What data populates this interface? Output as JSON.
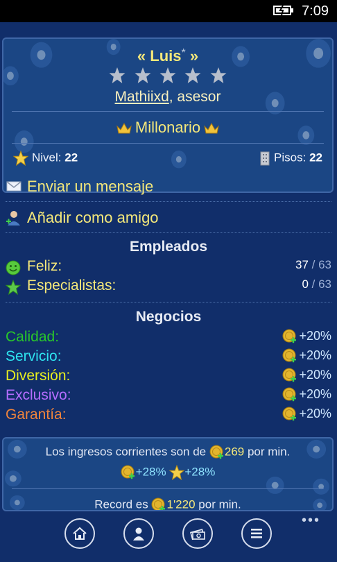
{
  "status_bar": {
    "time": "7:09"
  },
  "profile": {
    "title_open": "« ",
    "name": "Luis",
    "name_mark": "*",
    "title_close": " »",
    "star_rating": 0,
    "star_max": 5,
    "owner_link": "Mathiixd",
    "owner_suffix": ", asesor",
    "rank": "Millonario",
    "level_label": "Nivel: ",
    "level_value": "22",
    "floors_label": "Pisos: ",
    "floors_value": "22"
  },
  "actions": [
    {
      "label": "Enviar un mensaje",
      "icon": "envelope-icon"
    },
    {
      "label": "Añadir como amigo",
      "icon": "add-friend-icon"
    }
  ],
  "employees": {
    "heading": "Empleados",
    "rows": [
      {
        "label": "Feliz:",
        "value": "37",
        "total": " / 63",
        "icon": "smiley-icon"
      },
      {
        "label": "Especialistas:",
        "value": "0",
        "total": " / 63",
        "icon": "star-icon"
      }
    ]
  },
  "business": {
    "heading": "Negocios",
    "rows": [
      {
        "label": "Calidad:",
        "value": "+20%",
        "color": "#29c82a"
      },
      {
        "label": "Servicio:",
        "value": "+20%",
        "color": "#2ee3ef"
      },
      {
        "label": "Diversión:",
        "value": "+20%",
        "color": "#e8ef1f"
      },
      {
        "label": "Exclusivo:",
        "value": "+20%",
        "color": "#b46dff"
      },
      {
        "label": "Garantía:",
        "value": "+20%",
        "color": "#f0843c"
      }
    ]
  },
  "income": {
    "prefix": "Los ingresos corrientes son de ",
    "amount": "269",
    "suffix": " por min.",
    "bonus_coin": "+28%",
    "bonus_star": "+28%",
    "record_prefix": "Record es ",
    "record_amount": "1'220",
    "record_suffix": " por min."
  },
  "app_bar": {
    "more": "•••",
    "buttons": [
      "home-icon",
      "profile-icon",
      "money-icon",
      "list-icon"
    ]
  }
}
